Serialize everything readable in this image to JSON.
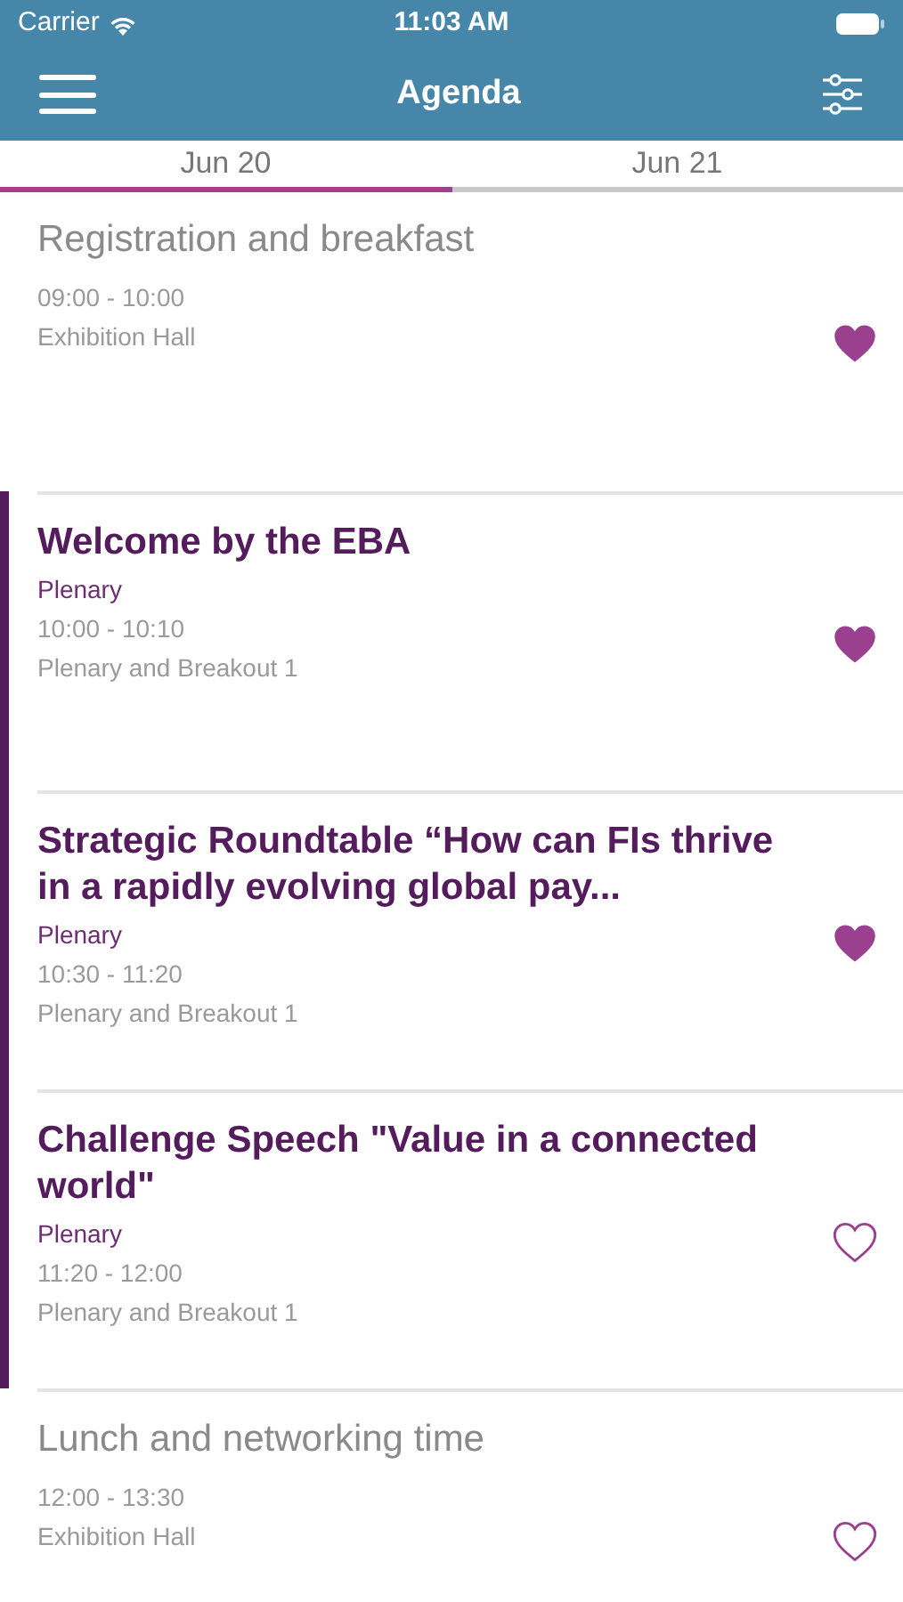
{
  "status_bar": {
    "carrier": "Carrier",
    "time": "11:03 AM"
  },
  "nav": {
    "title": "Agenda"
  },
  "tabs": [
    {
      "label": "Jun 20",
      "selected": true
    },
    {
      "label": "Jun 21",
      "selected": false
    }
  ],
  "sessions": [
    {
      "kind": "break",
      "title": "Registration and breakfast",
      "time": "09:00 - 10:00",
      "location": "Exhibition Hall",
      "current": false,
      "favorite": true
    },
    {
      "kind": "session",
      "title": "Welcome by the EBA",
      "track": "Plenary",
      "time": "10:00 - 10:10",
      "location": "Plenary and Breakout 1",
      "current": true,
      "favorite": true
    },
    {
      "kind": "session",
      "title": "Strategic Roundtable “How can FIs thrive in a rapidly evolving global pay...",
      "track": "Plenary",
      "time": "10:30 - 11:20",
      "location": "Plenary and Breakout 1",
      "current": true,
      "favorite": true
    },
    {
      "kind": "session",
      "title": "Challenge Speech \"Value in a connected world\"",
      "track": "Plenary",
      "time": "11:20 - 12:00",
      "location": "Plenary and Breakout 1",
      "current": true,
      "favorite": false
    },
    {
      "kind": "break",
      "title": "Lunch and networking time",
      "time": "12:00 - 13:30",
      "location": "Exhibition Hall",
      "current": false,
      "favorite": false
    }
  ]
}
